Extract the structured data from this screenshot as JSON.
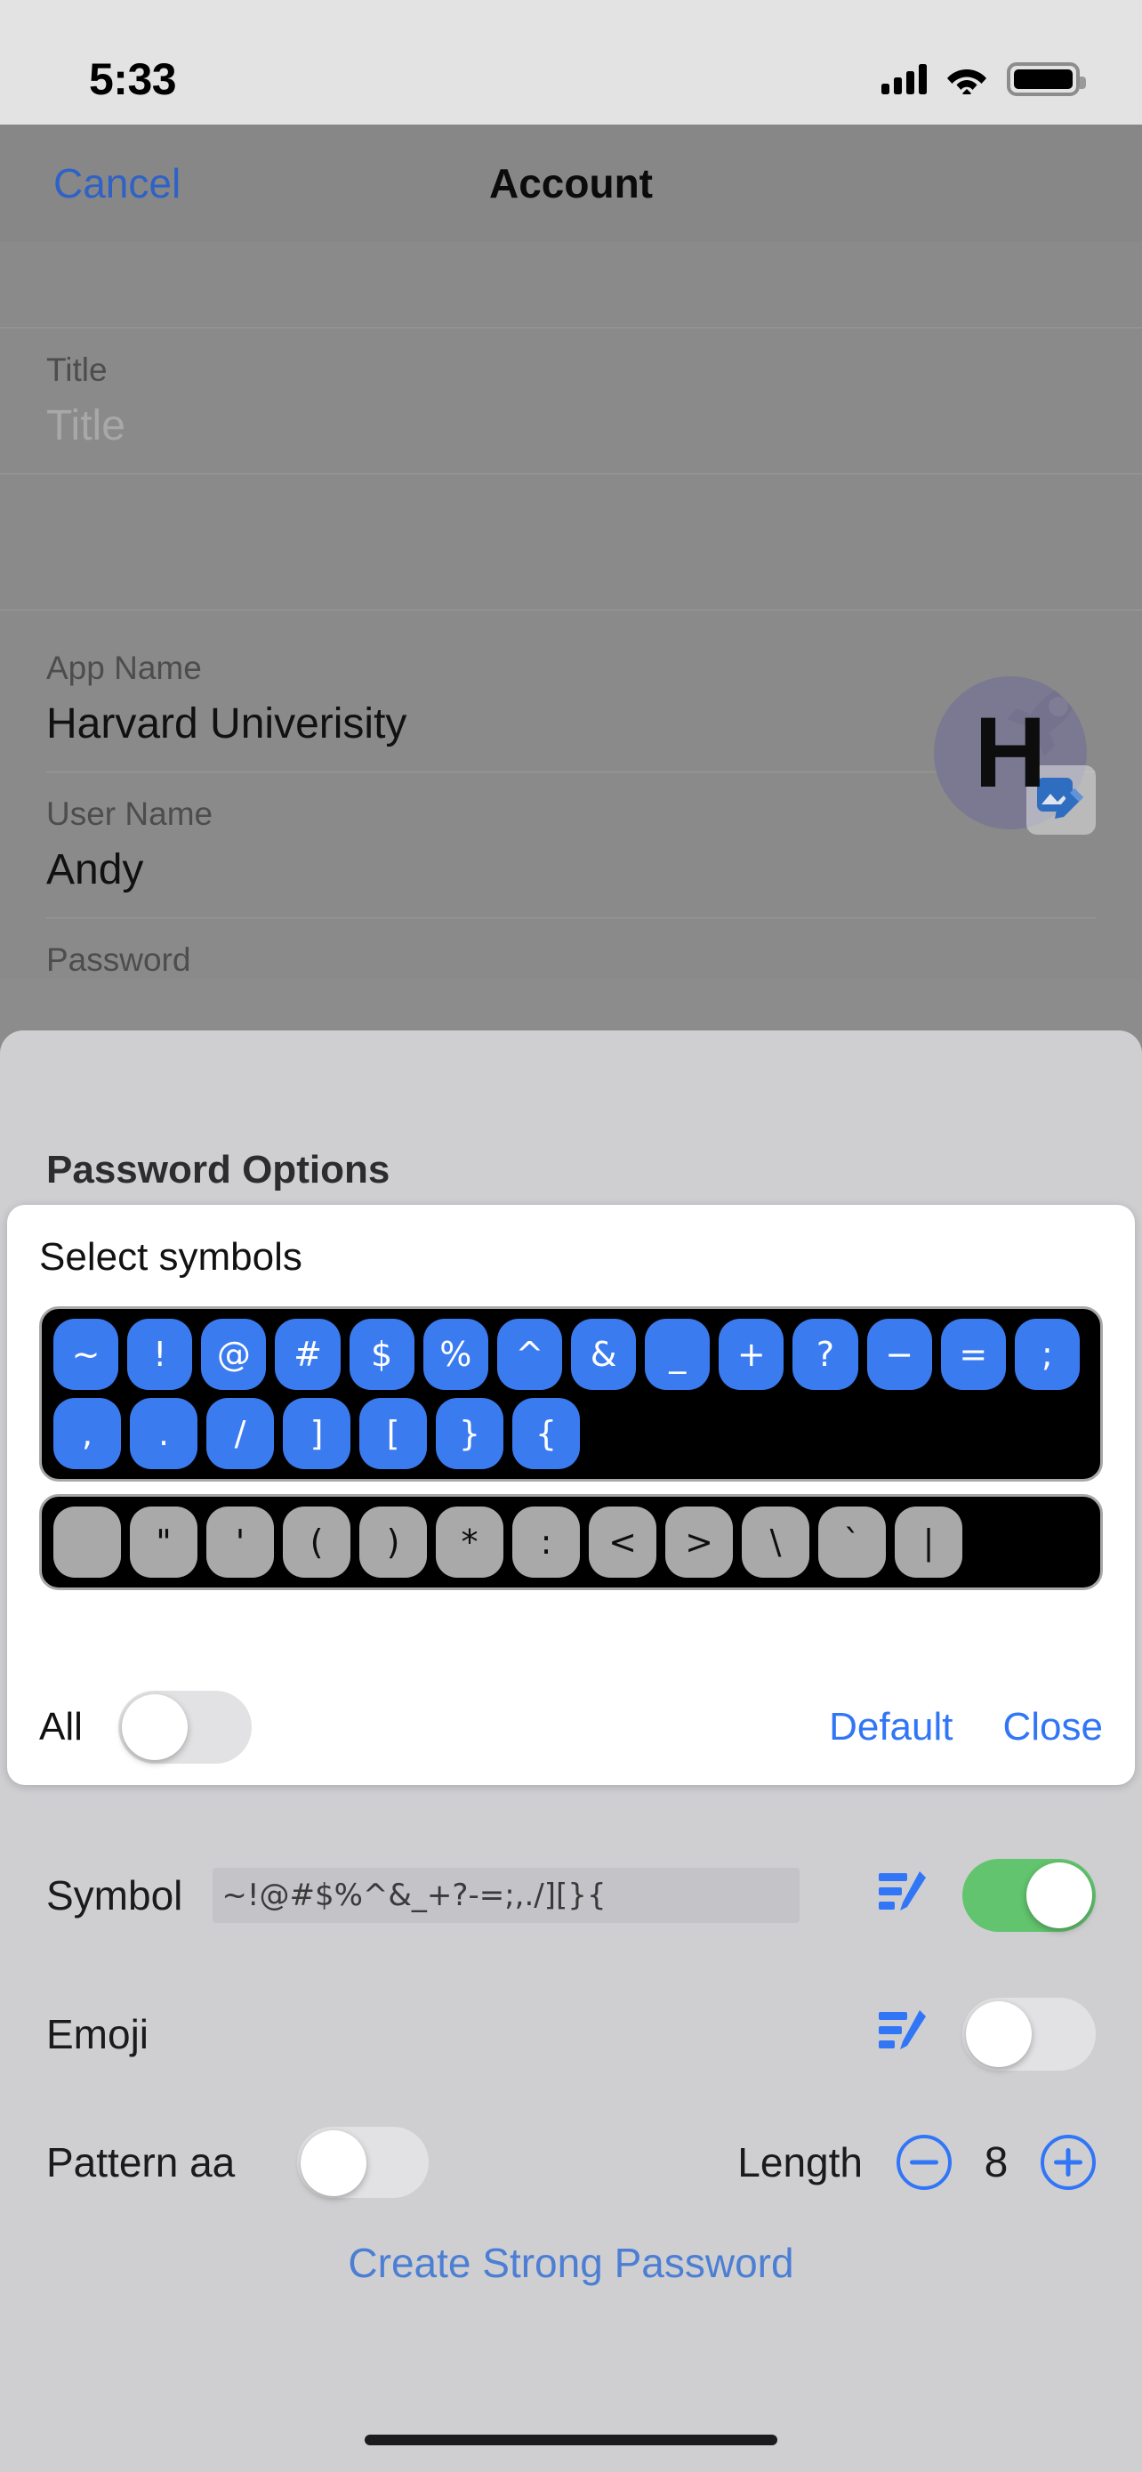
{
  "status_bar": {
    "time": "5:33",
    "cellular_icon": "cellular-bars-icon",
    "wifi_icon": "wifi-icon",
    "battery_icon": "battery-full-icon"
  },
  "nav_bar": {
    "cancel_label": "Cancel",
    "title": "Account"
  },
  "form": {
    "title_label": "Title",
    "title_placeholder": "Title",
    "app_name_label": "App Name",
    "app_name_value": "Harvard Univerisity",
    "user_name_label": "User Name",
    "user_name_value": "Andy",
    "password_label": "Password",
    "avatar_letter": "H",
    "avatar_edit_icon": "photo-edit-badge-icon"
  },
  "sheet": {
    "title": "Password Options",
    "symbol_card": {
      "heading": "Select symbols",
      "rows": [
        {
          "state": "on",
          "keys": [
            "~",
            "!",
            "@",
            "#",
            "$",
            "%",
            "^",
            "&",
            "_",
            "+",
            "?",
            "−",
            "=",
            ";"
          ]
        },
        {
          "state": "on",
          "keys": [
            ",",
            ".",
            "/",
            "]",
            "[",
            "}",
            "{"
          ]
        },
        {
          "state": "off",
          "keys": [
            " ",
            "\"",
            "'",
            "(",
            ")",
            "*",
            ":",
            "<",
            ">",
            "\\",
            "`",
            "|"
          ]
        }
      ],
      "all_label": "All",
      "all_enabled": false,
      "default_label": "Default",
      "close_label": "Close"
    },
    "options": [
      {
        "name": "symbol",
        "label": "Symbol",
        "value": "~!@#$%^&_+?-=;,./][}{",
        "edit_icon": "list-edit-icon",
        "enabled": true
      },
      {
        "name": "emoji",
        "label": "Emoji",
        "value": "",
        "edit_icon": "list-edit-icon",
        "enabled": false
      }
    ],
    "pattern": {
      "label": "Pattern aa",
      "enabled": false
    },
    "length": {
      "label": "Length",
      "value": "8",
      "minus_icon": "minus-circle-icon",
      "plus_icon": "plus-circle-icon"
    },
    "create_button_label": "Create Strong Password"
  },
  "colors": {
    "accent_blue": "#3176f6",
    "toggle_on_green": "#62c46e",
    "key_on_blue": "#3b7bf0",
    "key_off_gray": "#a9a9a9"
  }
}
